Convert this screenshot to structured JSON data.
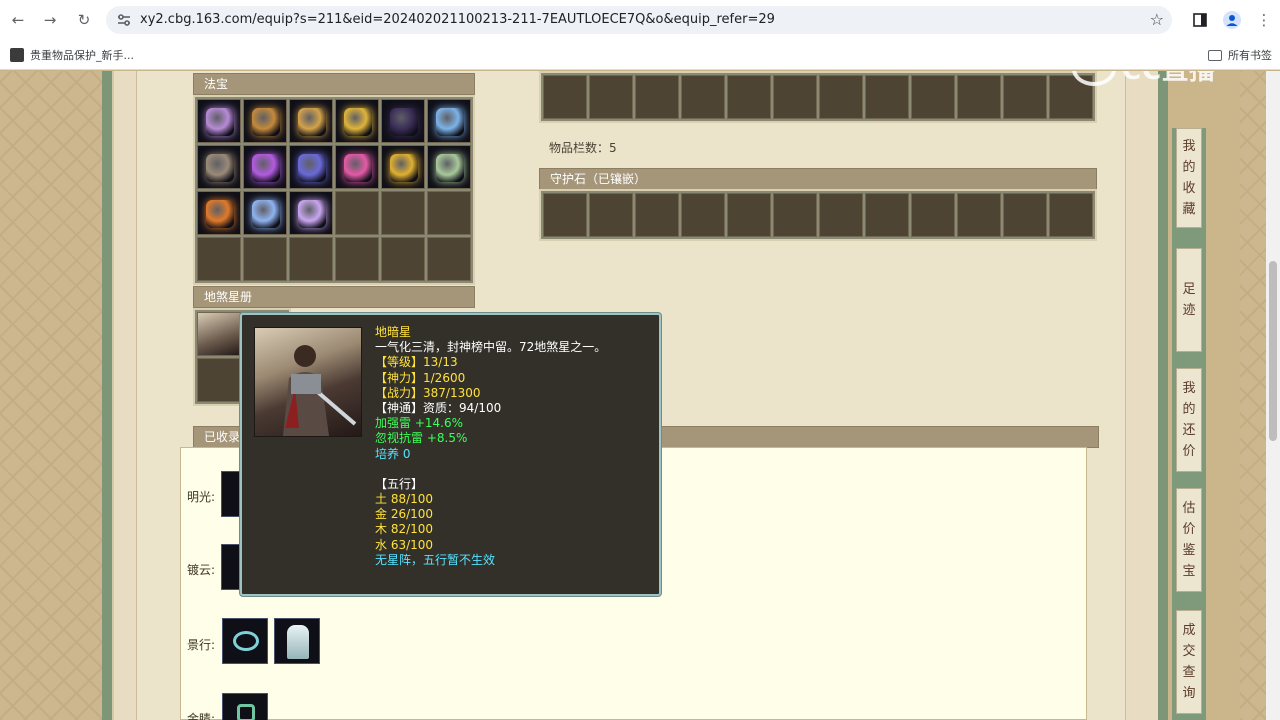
{
  "browser": {
    "url": "xy2.cbg.163.com/equip?s=211&eid=202402021100213-211-7EAUTLOECE7Q&o&equip_refer=29",
    "bookmark_label": "贵重物品保护_新手...",
    "all_bookmarks_label": "所有书签"
  },
  "watermark": "CC直播",
  "fabao": {
    "title": "法宝",
    "item_colors": [
      "#b78bd6",
      "#c38a3b",
      "#d4a24a",
      "#e0b43a",
      "#3b2e58",
      "#7db3e8",
      "#9a8a78",
      "#b35be0",
      "#6a6ad8",
      "#e45aa6",
      "#e0b030",
      "#a8c89a",
      "#e07a2a",
      "#8fb3f0",
      "#c9a6f0"
    ]
  },
  "disha": {
    "title": "地煞星册"
  },
  "inventory": {
    "count_text": "物品栏数：5"
  },
  "guard_stone": {
    "title": "守护石（已镶嵌）"
  },
  "collected": {
    "title": "已收录的",
    "rows": [
      {
        "label": "明光:",
        "thumbs": 1
      },
      {
        "label": "镀云:",
        "thumbs": 1
      },
      {
        "label": "景行:",
        "thumbs": 2
      },
      {
        "label": "金睛:",
        "thumbs": 1
      }
    ]
  },
  "tooltip": {
    "lines": [
      {
        "text": "地暗星",
        "color": "yellow"
      },
      {
        "text": "一气化三清，封神榜中留。72地煞星之一。",
        "color": "white"
      },
      {
        "text": "【等级】13/13",
        "color": "yellow"
      },
      {
        "text": "【神力】1/2600",
        "color": "yellow"
      },
      {
        "text": "【战力】387/1300",
        "color": "yellow"
      },
      {
        "text": "【神通】资质：94/100",
        "color": "white"
      },
      {
        "text": "加强雷 +14.6%",
        "color": "green"
      },
      {
        "text": "忽视抗雷 +8.5%",
        "color": "green"
      },
      {
        "text": "培养 0",
        "color": "cyan"
      },
      {
        "text": "",
        "color": "white"
      },
      {
        "text": "【五行】",
        "color": "white"
      },
      {
        "text": "土 88/100",
        "color": "yellow"
      },
      {
        "text": "金 26/100",
        "color": "yellow"
      },
      {
        "text": "木 82/100",
        "color": "yellow"
      },
      {
        "text": "水 63/100",
        "color": "yellow"
      },
      {
        "text": "无星阵，五行暂不生效",
        "color": "cyan"
      }
    ]
  },
  "side_tabs": [
    {
      "label": "我的收藏"
    },
    {
      "label": "足迹"
    },
    {
      "label": "我的还价"
    },
    {
      "label": "估价鉴宝"
    },
    {
      "label": "成交查询"
    }
  ]
}
